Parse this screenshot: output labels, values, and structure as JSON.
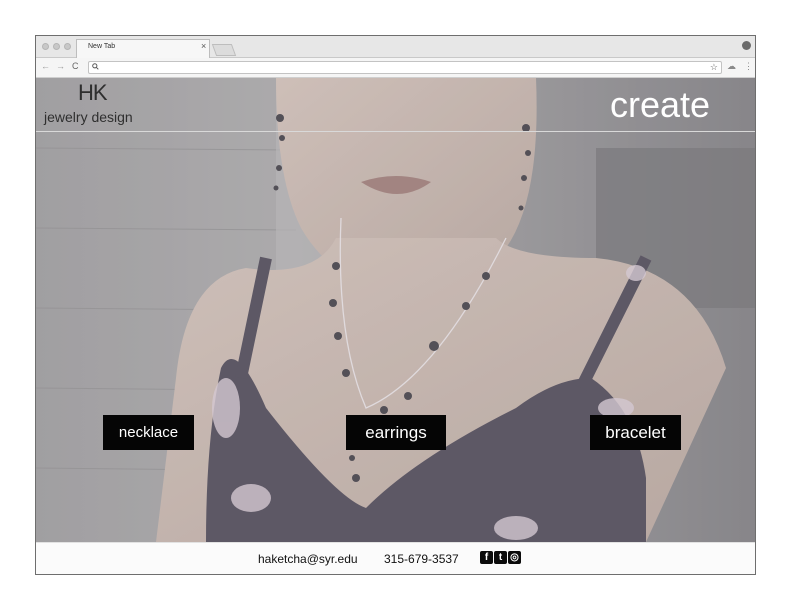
{
  "browser": {
    "tab_title": "New Tab",
    "tab_close": "×",
    "nav_back": "←",
    "nav_forward": "→",
    "nav_reload": "C",
    "omnibox_icon": "search-icon",
    "omnibox_value": "",
    "bookmark_icon": "star-icon",
    "menu_icon": "⋮"
  },
  "header": {
    "logo_mark": "HK",
    "logo_sub": "jewelry design",
    "create_label": "create"
  },
  "categories": {
    "necklace": "necklace",
    "earrings": "earrings",
    "bracelet": "bracelet"
  },
  "footer": {
    "email": "haketcha@syr.edu",
    "phone": "315-679-3537",
    "social": {
      "facebook": "f",
      "twitter": "t",
      "instagram": "◎"
    }
  },
  "colors": {
    "button_bg": "#050505",
    "button_text": "#ffffff",
    "dress": "#3a3444",
    "skin": "#b9a79f"
  }
}
